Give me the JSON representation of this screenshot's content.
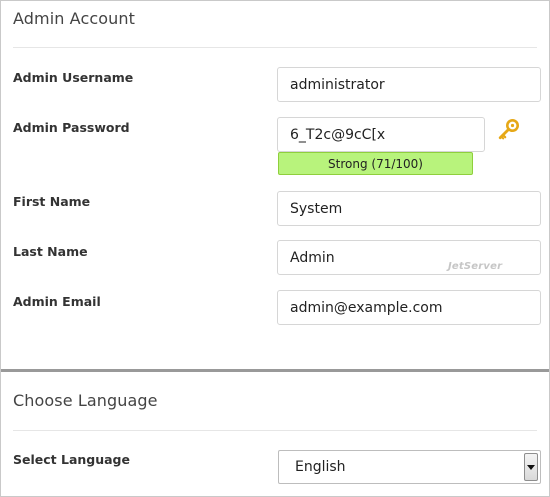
{
  "admin_account": {
    "title": "Admin Account",
    "username": {
      "label": "Admin Username",
      "value": "administrator"
    },
    "password": {
      "label": "Admin Password",
      "value": "6_T2c@9cC[x",
      "strength": "Strong (71/100)",
      "strength_score": 71
    },
    "first_name": {
      "label": "First Name",
      "value": "System"
    },
    "last_name": {
      "label": "Last Name",
      "value": "Admin"
    },
    "email": {
      "label": "Admin Email",
      "value": "admin@example.com"
    }
  },
  "watermark": "JetServer",
  "language": {
    "title": "Choose Language",
    "select_label": "Select Language",
    "selected": "English"
  },
  "icons": {
    "generate_password": "key-icon",
    "dropdown": "chevron-down-icon"
  },
  "colors": {
    "strength_bg": "#b8f37c",
    "strength_border": "#8fcf3c",
    "key_icon": "#e6a817"
  }
}
